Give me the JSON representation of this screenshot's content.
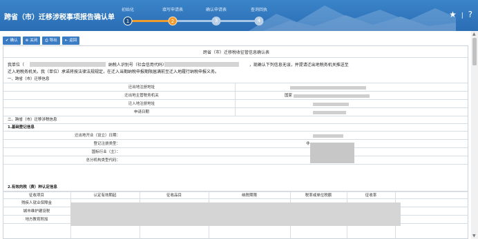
{
  "header": {
    "title": "跨省（市）迁移涉税事项报告确认单",
    "steps": [
      {
        "label": "初始化",
        "num": "1",
        "state": "done"
      },
      {
        "label": "填写申请表",
        "num": "2",
        "state": "active"
      },
      {
        "label": "确认申请表",
        "num": "3",
        "state": "todo"
      },
      {
        "label": "查询回执",
        "num": "4",
        "state": "todo"
      }
    ],
    "icons": {
      "favorite": "★",
      "separator": "|",
      "help": "?"
    }
  },
  "toolbar": {
    "buttons": [
      {
        "icon": "✔",
        "label": "确认"
      },
      {
        "icon": "⊗",
        "label": "关闭"
      },
      {
        "icon": "⎙",
        "label": "导出"
      },
      {
        "icon": "⇤",
        "label": "返回"
      }
    ]
  },
  "document": {
    "title": "跨省（市）迁移税收征管信息确认表",
    "decl_line1_a": "我单位（",
    "decl_line1_b": "纳税人识别号（社会信用代码）",
    "decl_line1_c": "，现确认下列信息无误，并提请迁出地税务机关推送至",
    "decl_line2": "迁入地税务机关。我（单位）承诺将按法律法规规定，在迁入当期纳税申报期限届满前至迁入地履行纳税申报义务。",
    "section1": "一、跨省（市）迁移信息",
    "section1_rows": [
      {
        "label": "迁出地注册地址"
      },
      {
        "label": "迁出地主管税务机关",
        "value": "国家"
      },
      {
        "label": "迁入地注册地址"
      },
      {
        "label": "申请日期"
      }
    ],
    "section2": "二、跨省（市）迁移涉税信息",
    "sub1": "1.基础登记信息",
    "sub1_rows": [
      {
        "label": "迁出地开业（设立）日期："
      },
      {
        "label": "登记注册类型：",
        "value": "非"
      },
      {
        "label": "国标行业（主）："
      },
      {
        "label": "总分机构类型代码："
      }
    ],
    "sub2": "2.有效的税（费）种认定信息",
    "table_headers": [
      "征收项目",
      "认定有效期起",
      "征收品目",
      "纳税期限",
      "税率或单位税额",
      "征收率"
    ],
    "table_rows": [
      "残疾人就业保障金",
      "城市维护建设税",
      "地方教育附加"
    ]
  }
}
